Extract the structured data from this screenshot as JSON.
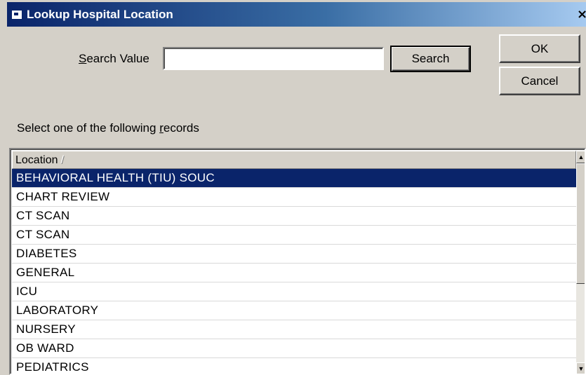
{
  "window": {
    "title": "Lookup Hospital Location",
    "close_glyph": "×"
  },
  "search": {
    "label": "Search Value",
    "value": "",
    "button_label": "Search"
  },
  "buttons": {
    "ok_label": "OK",
    "cancel_label": "Cancel"
  },
  "instruction": "Select one of the following records",
  "list": {
    "column_header": "Location",
    "sort_indicator": "/",
    "selected_index": 0,
    "rows": [
      "BEHAVIORAL HEALTH (TIU) SOUC",
      "CHART REVIEW",
      "CT SCAN",
      "CT SCAN",
      "DIABETES",
      "GENERAL",
      "ICU",
      "LABORATORY",
      "NURSERY",
      "OB WARD",
      "PEDIATRICS"
    ]
  },
  "icons": {
    "title": "app-icon",
    "close": "close-icon",
    "scroll_up": "scroll-up-arrow-icon",
    "scroll_down": "scroll-down-arrow-icon"
  },
  "colors": {
    "title_bar": "#0a246a",
    "selection": "#0a246a",
    "face": "#d4d0c8"
  }
}
